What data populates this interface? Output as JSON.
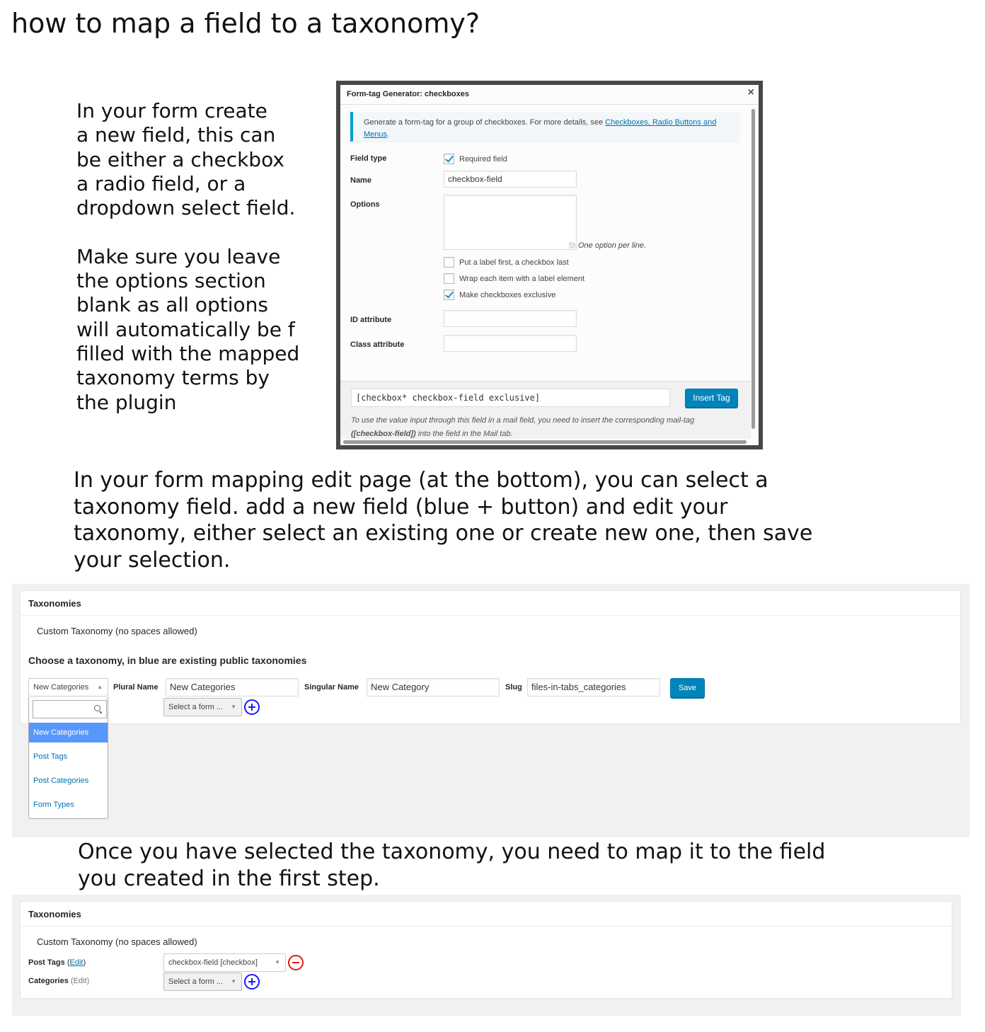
{
  "page": {
    "title": "how to map a field to a taxonomy?",
    "intro": "In your form create\na new field, this can\nbe either a checkbox\na radio field, or a\ndropdown select field.\n\nMake sure you leave\nthe options section\nblank as all options\nwill automatically be f\nfilled with the mapped\ntaxonomy terms by\nthe plugin",
    "step2": "In your form mapping edit page (at the bottom), you can select a taxonomy field.  add a new field (blue + button) and edit your taxonomy, either select an existing one or create new one, then save your selection.",
    "step3": "Once you have selected the taxonomy, you need to map it to the field you created in the first step."
  },
  "modal": {
    "title": "Form-tag Generator: checkboxes",
    "close": "×",
    "notice_text": "Generate a form-tag for a group of checkboxes. For more details, see ",
    "notice_link": "Checkboxes, Radio Buttons and Menus",
    "notice_end": ".",
    "field_type_label": "Field type",
    "required_label": "Required field",
    "required_checked": true,
    "name_label": "Name",
    "name_value": "checkbox-field",
    "options_label": "Options",
    "options_hint": "One option per line.",
    "label_first": "Put a label first, a checkbox last",
    "label_first_checked": false,
    "wrap_label": "Wrap each item with a label element",
    "wrap_label_checked": false,
    "exclusive": "Make checkboxes exclusive",
    "exclusive_checked": true,
    "id_label": "ID attribute",
    "class_label": "Class attribute",
    "tag_output": "[checkbox* checkbox-field exclusive]",
    "insert_tag": "Insert Tag",
    "footer_hint_1": "To use the value input through this field in a mail field, you need to insert the corresponding mail-tag",
    "footer_hint_tag": "([checkbox-field])",
    "footer_hint_2": " into the field in the Mail tab."
  },
  "panel1": {
    "title": "Taxonomies",
    "custom_label": "Custom Taxonomy (no spaces allowed)",
    "choose_label": "Choose a taxonomy, in blue are existing public taxonomies",
    "taxonomy_select": "New Categories",
    "plural_label": "Plural Name",
    "plural_value": "New Categories",
    "singular_label": "Singular Name",
    "singular_value": "New Category",
    "slug_label": "Slug",
    "slug_value": "files-in-tabs_categories",
    "save": "Save",
    "form_select": "Select a form ...",
    "dropdown_items": [
      "New Categories",
      "Post Tags",
      "Post Categories",
      "Form Types"
    ],
    "dropdown_selected_index": 0,
    "colors": {
      "accent": "#0085ba",
      "plus": "#1a1aff",
      "highlight": "#5897fb"
    }
  },
  "panel2": {
    "title": "Taxonomies",
    "custom_label": "Custom Taxonomy (no spaces allowed)",
    "row1_label": "Post Tags",
    "row1_edit": "Edit",
    "row1_select": "checkbox-field [checkbox]",
    "row2_label": "Categories",
    "row2_edit": "Edit",
    "row2_select": "Select a form ...",
    "colors": {
      "minus": "#e01b1b",
      "plus": "#1a1aff"
    }
  },
  "icons": [
    "close-icon",
    "checkmark-icon",
    "resize-grip-icon",
    "search-icon",
    "chevron-down-icon",
    "plus-circle-icon",
    "minus-circle-icon"
  ]
}
